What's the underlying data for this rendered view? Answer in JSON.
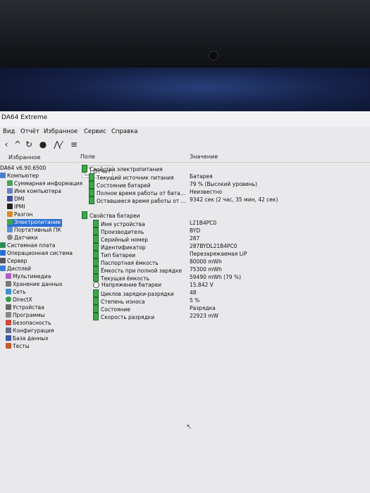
{
  "window": {
    "title": "DA64 Extreme"
  },
  "menu": [
    "Вид",
    "Отчёт",
    "Избранное",
    "Сервис",
    "Справка"
  ],
  "toolbar": {
    "report_label": "Отчёт"
  },
  "sidebar": {
    "header": "Избранное",
    "version": "DA64 v6.90.6500",
    "items": [
      "Компьютер",
      "Суммарная информация",
      "Имя компьютера",
      "DMI",
      "IPMI",
      "Разгон",
      "Электропитание",
      "Портативный ПК",
      "Датчики",
      "Системная плата",
      "Операционная система",
      "Сервер",
      "Дисплей",
      "Мультимедиа",
      "Хранение данных",
      "Сеть",
      "DirectX",
      "Устройства",
      "Программы",
      "Безопасность",
      "Конфигурация",
      "База данных",
      "Тесты"
    ]
  },
  "columns": {
    "field": "Поле",
    "value": "Значение"
  },
  "power": {
    "group": "Свойства электропитания",
    "rows": [
      {
        "field": "Текущий источник питания",
        "value": "Батарея"
      },
      {
        "field": "Состояние батарей",
        "value": "79 % (Высокий уровень)"
      },
      {
        "field": "Полное время работы от бата...",
        "value": "Неизвестно"
      },
      {
        "field": "Оставшееся время работы от ...",
        "value": "9342 сек (2 час, 35 мин, 42 сек)"
      }
    ]
  },
  "battery": {
    "group": "Свойства батареи",
    "rows": [
      {
        "field": "Имя устройства",
        "value": "L21B4PC0"
      },
      {
        "field": "Производитель",
        "value": "BYD"
      },
      {
        "field": "Серийный номер",
        "value": "287"
      },
      {
        "field": "Идентификатор",
        "value": "287BYDL21B4PC0"
      },
      {
        "field": "Тип батареи",
        "value": "Перезаряжаемая LiP"
      },
      {
        "field": "Паспортная ёмкость",
        "value": "80000 mWh"
      },
      {
        "field": "Ёмкость при полной зарядке",
        "value": "75300 mWh"
      },
      {
        "field": "Текущая ёмкость",
        "value": "59490 mWh  (79 %)"
      },
      {
        "field": "Напряжение батареи",
        "value": "15.842 V"
      },
      {
        "field": "Циклов зарядки-разрядки",
        "value": "48"
      },
      {
        "field": "Степень износа",
        "value": "5 %"
      },
      {
        "field": "Состояние",
        "value": "Разрядка"
      },
      {
        "field": "Скорость разрядки",
        "value": "22923 mW"
      }
    ]
  }
}
